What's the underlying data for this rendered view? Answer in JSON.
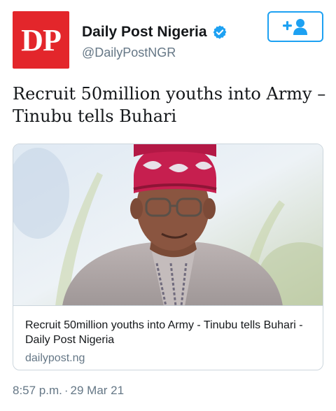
{
  "account": {
    "logo_text": "DP",
    "display_name": "Daily Post Nigeria",
    "handle": "@DailyPostNGR",
    "verified": true,
    "brand_color": "#e3262b",
    "verified_color": "#1da1f2"
  },
  "follow_button": {
    "icon": "add-user-icon",
    "color": "#1da1f2"
  },
  "tweet": {
    "text": "Recruit 50million youths into Army – Tinubu tells Buhari"
  },
  "link_card": {
    "image": "portrait-photo",
    "title": "Recruit 50million youths into Army - Tinubu tells Buhari - Daily Post Nigeria",
    "domain": "dailypost.ng"
  },
  "meta": {
    "time": "8:57 p.m.",
    "separator": "·",
    "date": "29 Mar 21"
  }
}
